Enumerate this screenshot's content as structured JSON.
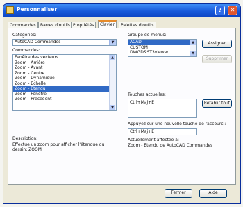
{
  "window": {
    "title": "Personnaliser"
  },
  "tabs": [
    "Commandes",
    "Barres d'outils",
    "Propriétés",
    "Clavier",
    "Palettes d'outils"
  ],
  "left": {
    "categories_label": "Catégories:",
    "categories_value": "AutoCAD Commandes",
    "commands_label": "Commandes:",
    "commands": [
      "Fenêtre des vecteurs",
      "Zoom - Arrière",
      "Zoom - Avant",
      "Zoom - Centre",
      "Zoom - Dynamique",
      "Zoom - Echelle",
      "Zoom - Etendu",
      "Zoom - Fenêtre",
      "Zoom - Précédent"
    ],
    "commands_selected_index": 6,
    "description_label": "Description:",
    "description_text": "Effectue un zoom pour afficher l'étendue du dessin: ZOOM"
  },
  "right": {
    "menu_group_label": "Groupe de menus:",
    "menu_groups": [
      "ACAD",
      "CUSTOM",
      "DWGD&ST3viewer"
    ],
    "menu_group_selected_index": 0,
    "assign_button": "Assigner",
    "remove_button": "Supprimer",
    "current_keys_label": "Touches actuelles:",
    "current_keys_value": "Ctrl+Maj+E",
    "reset_all_button": "Rétablir tout",
    "new_shortcut_label": "Appuyez sur une nouvelle touche de raccourci:",
    "new_shortcut_value": "Ctrl+Maj+E",
    "currently_assigned_label": "Actuellement affectée à:",
    "currently_assigned_value": "Zoom - Etendu de AutoCAD Commandes"
  },
  "footer": {
    "close_button": "Fermer",
    "help_button": "Aide"
  }
}
